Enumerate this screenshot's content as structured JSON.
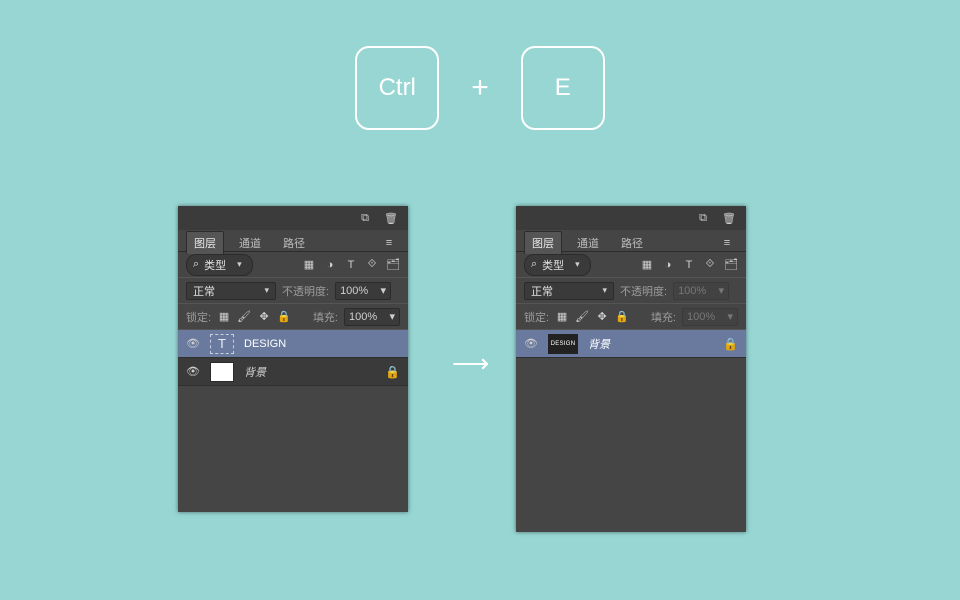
{
  "keys": {
    "left": "Ctrl",
    "plus": "+",
    "right": "E"
  },
  "arrow": "⟶",
  "tabs": {
    "layers": "图层",
    "channels": "通道",
    "paths": "路径"
  },
  "filter": {
    "search_glyph": "⌕",
    "label": "类型"
  },
  "blend": {
    "mode": "正常",
    "opacity_label": "不透明度:",
    "opacity_value": "100%",
    "lock_label": "锁定:",
    "fill_label": "填充:",
    "fill_value": "100%"
  },
  "icons": {
    "collapse": "⧉",
    "trash": "🗑",
    "menu": "≡",
    "img": "▦",
    "circle": "◑",
    "T": "T",
    "crop": "⟐",
    "clip": "🗂",
    "pixel": "▦",
    "brush": "🖌",
    "move": "✥",
    "lock": "🔒"
  },
  "left_panel": {
    "layers": [
      {
        "eye": "👁",
        "thumb_letter": "T",
        "name": "DESIGN",
        "selected": true,
        "italic": false,
        "lock": ""
      },
      {
        "eye": "👁",
        "thumb_type": "white",
        "name": "背景",
        "selected": false,
        "italic": true,
        "lock": "🔒"
      }
    ]
  },
  "right_panel": {
    "dim_percent": "100%",
    "layers": [
      {
        "eye": "👁",
        "thumb_text": "DESIGN",
        "name": "背景",
        "selected": true,
        "italic": true,
        "lock": "🔒"
      }
    ]
  }
}
